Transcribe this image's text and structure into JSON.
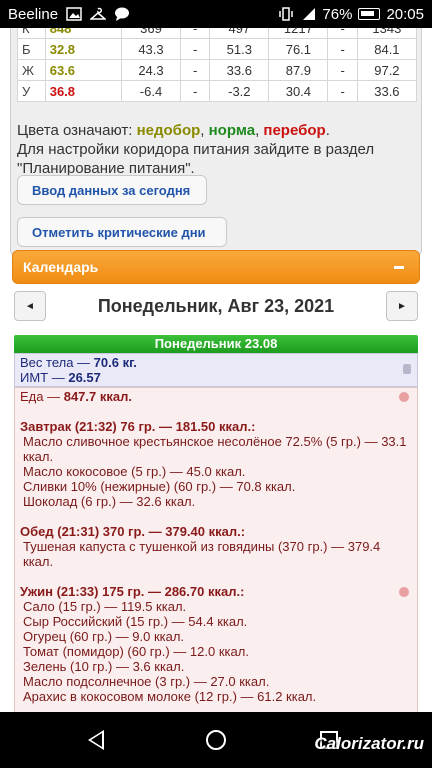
{
  "statusbar": {
    "carrier": "Beeline",
    "battery": "76%",
    "time": "20:05"
  },
  "norms": {
    "rows": [
      {
        "key": "К",
        "value": "848",
        "color": "#8a8a00",
        "min1": "369",
        "max1": "497",
        "min2": "1217",
        "max2": "1343"
      },
      {
        "key": "Б",
        "value": "32.8",
        "color": "#8a8a00",
        "min1": "43.3",
        "max1": "51.3",
        "min2": "76.1",
        "max2": "84.1"
      },
      {
        "key": "Ж",
        "value": "63.6",
        "color": "#8a8a00",
        "min1": "24.3",
        "max1": "33.6",
        "min2": "87.9",
        "max2": "97.2"
      },
      {
        "key": "У",
        "value": "36.8",
        "color": "#cc1111",
        "min1": "-6.4",
        "max1": "-3.2",
        "min2": "30.4",
        "max2": "33.6"
      }
    ]
  },
  "legend": {
    "prefix": "Цвета означают: ",
    "under": "недобор",
    "sep1": ", ",
    "norm": "норма",
    "sep2": ", ",
    "over": "перебор",
    "suffix": ".",
    "hint": "Для настройки коридора питания зайдите в раздел \"Планирование питания\"."
  },
  "buttons": {
    "enter_today": "Ввод данных за сегодня",
    "mark_critical": "Отметить критические дни"
  },
  "calendar": {
    "header": "Календарь",
    "prev": "◄",
    "next": "►",
    "date_title": "Понедельник, Авг 23, 2021",
    "day_bar": "Понедельник 23.08"
  },
  "body": {
    "weight_label": "Вес тела — ",
    "weight_value": "70.6 кг.",
    "bmi_label": "ИМТ — ",
    "bmi_value": "26.57"
  },
  "food": {
    "total_label": "Еда — ",
    "total_value": "847.7 ккал.",
    "meals": [
      {
        "title": "Завтрак (21:32) 76 гр. — 181.50 ккал.:",
        "items": [
          "Масло сливочное крестьянское несолёное 72.5% (5 гр.) — 33.1",
          "ккал.",
          "Масло кокосовое (5 гр.) — 45.0 ккал.",
          "Сливки 10% (нежирные) (60 гр.) — 70.8 ккал.",
          "Шоколад (6 гр.) — 32.6 ккал."
        ]
      },
      {
        "title": "Обед (21:31) 370 гр. — 379.40 ккал.:",
        "items": [
          "Тушеная капуста с тушенкой из говядины (370 гр.) — 379.4",
          "ккал."
        ]
      },
      {
        "title": "Ужин (21:33) 175 гр. — 286.70 ккал.:",
        "items": [
          "Сало (15 гр.) — 119.5 ккал.",
          "Сыр Российский (15 гр.) — 54.4 ккал.",
          "Огурец (60 гр.) — 9.0 ккал.",
          "Томат (помидор) (60 гр.) — 12.0 ккал.",
          "Зелень (10 гр.) — 3.6 ккал.",
          "Масло подсолнечное (3 гр.) — 27.0 ккал.",
          "Арахис в кокосовом молоке (12 гр.) — 61.2 ккал."
        ]
      }
    ]
  },
  "watermark": "Calorizator.ru"
}
